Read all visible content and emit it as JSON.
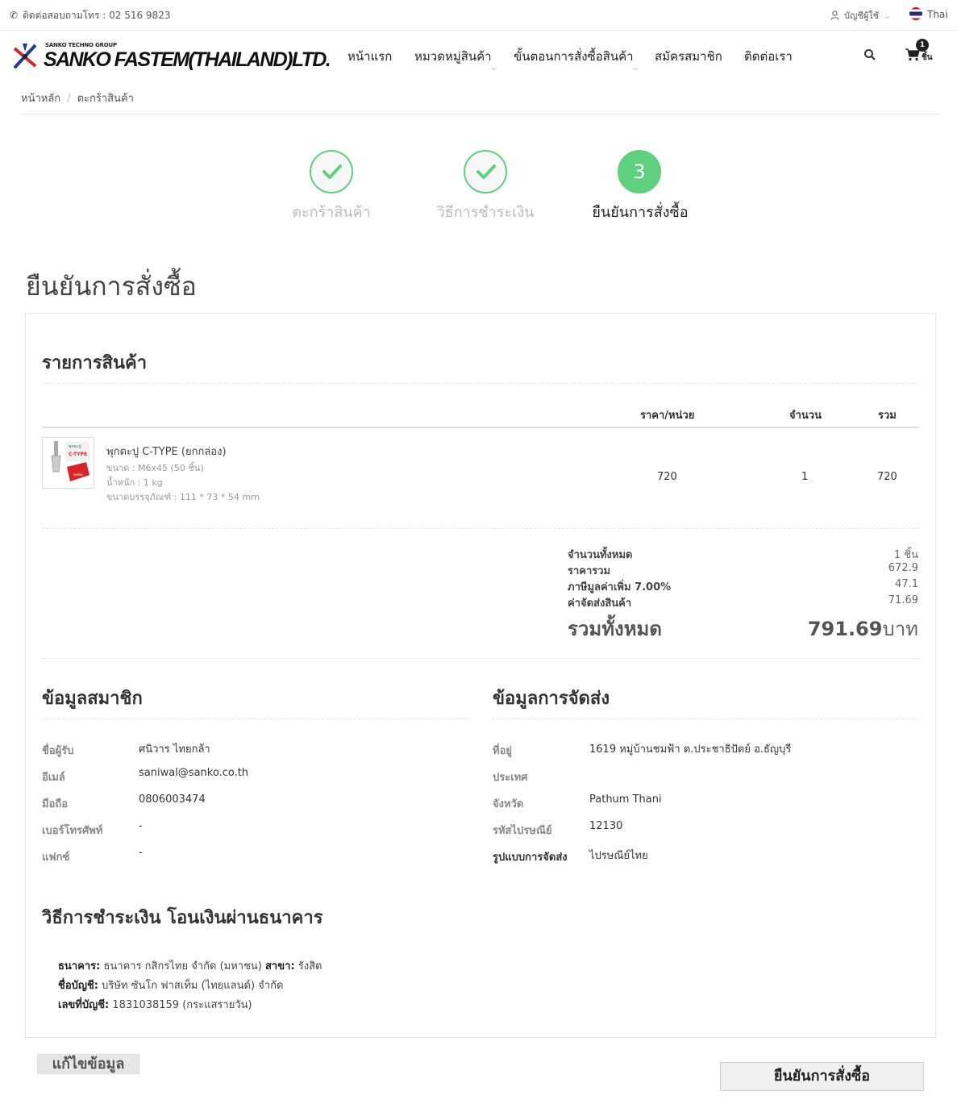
{
  "topbar": {
    "contact": "ติดต่อสอบถามโทร : 02 516 9823",
    "account_label": "บัญชีผู้ใช้",
    "language": "Thai"
  },
  "header": {
    "logo_group": "SANKO TECHNO GROUP",
    "logo_name": "SANKO FASTEM(THAILAND)LTD.",
    "nav": [
      "หน้าแรก",
      "หมวดหมู่สินค้า",
      "ขั้นตอนการสั่งซื้อสินค้า",
      "สมัครสมาชิก",
      "ติดต่อเรา"
    ],
    "cart_count": "1",
    "cart_unit": "ชิ้น"
  },
  "breadcrumb": [
    "หน้าหลัก",
    "ตะกร้าสินค้า"
  ],
  "steps": [
    {
      "label": "ตะกร้าสินค้า",
      "state": "done"
    },
    {
      "label": "วิธีการชำระเงิน",
      "state": "done"
    },
    {
      "label": "ยืนยันการสั่งซื้อ",
      "state": "active",
      "number": "3"
    }
  ],
  "page_title": "ยืนยันการสั่งซื้อ",
  "order": {
    "title": "รายการสินค้า",
    "headers": {
      "price": "ราคา/หน่วย",
      "qty": "จำนวน",
      "total": "รวม"
    },
    "item": {
      "name": "พุกตะปู C-TYPE (ยกกล่อง)",
      "size": "ขนาด : M6x45 (50 ชิ้น)",
      "weight": "น้ำหนัก : 1 kg",
      "package": "ขนาดบรรจุภัณฑ์ : 111 * 73 * 54 mm",
      "price": "720",
      "qty": "1",
      "total": "720"
    },
    "summary": [
      {
        "label": "จำนวนทั้งหมด",
        "value": "1 ชิ้น"
      },
      {
        "label": "ราคารวม",
        "value": "672.9"
      },
      {
        "label": "ภาษีมูลค่าเพิ่ม 7.00%",
        "value": "47.1"
      },
      {
        "label": "ค่าจัดส่งสินค้า",
        "value": "71.69"
      }
    ],
    "grand_label": "รวมทั้งหมด",
    "grand_value": "791.69",
    "currency": "บาท"
  },
  "member": {
    "title": "ข้อมูลสมาชิก",
    "rows": [
      {
        "label": "ชื่อผู้รับ",
        "value": "ศนิวาร ไทยกล้า"
      },
      {
        "label": "อีเมล์",
        "value": "saniwal@sanko.co.th"
      },
      {
        "label": "มือถือ",
        "value": "0806003474"
      },
      {
        "label": "เบอร์โทรศัพท์",
        "value": "-"
      },
      {
        "label": "แฟกซ์",
        "value": "-"
      }
    ]
  },
  "shipping": {
    "title": "ข้อมูลการจัดส่ง",
    "rows": [
      {
        "label": "ที่อยู่",
        "value": "1619 หมู่บ้านชมฟ้า ต.ประชาธิปัตย์ อ.ธัญบุรี"
      },
      {
        "label": "ประเทศ",
        "value": ""
      },
      {
        "label": "จังหวัด",
        "value": "Pathum Thani"
      },
      {
        "label": "รหัสไปรษณีย์",
        "value": "12130"
      },
      {
        "label": "รูปแบบการจัดส่ง",
        "value": "ไปรษณีย์ไทย"
      }
    ]
  },
  "payment": {
    "title": "วิธีการชำระเงิน โอนเงินผ่านธนาคาร",
    "bank_label": "ธนาคาร:",
    "bank_value": "ธนาคาร กสิกรไทย จำกัด (มหาชน)",
    "branch_label": "สาขา:",
    "branch_value": "รังสิต",
    "account_name_label": "ชื่อบัญชี:",
    "account_name_value": "บริษัท ซันโก ฟาสเท็ม (ไทยแลนด์) จำกัด",
    "account_no_label": "เลขที่บัญชี:",
    "account_no_value": "1831038159 (กระแสรายวัน)"
  },
  "buttons": {
    "edit": "แก้ไขข้อมูล",
    "confirm": "ยืนยันการสั่งซื้อ"
  },
  "colors": {
    "accent": "#5fd07d",
    "muted": "#bbbbbb"
  }
}
